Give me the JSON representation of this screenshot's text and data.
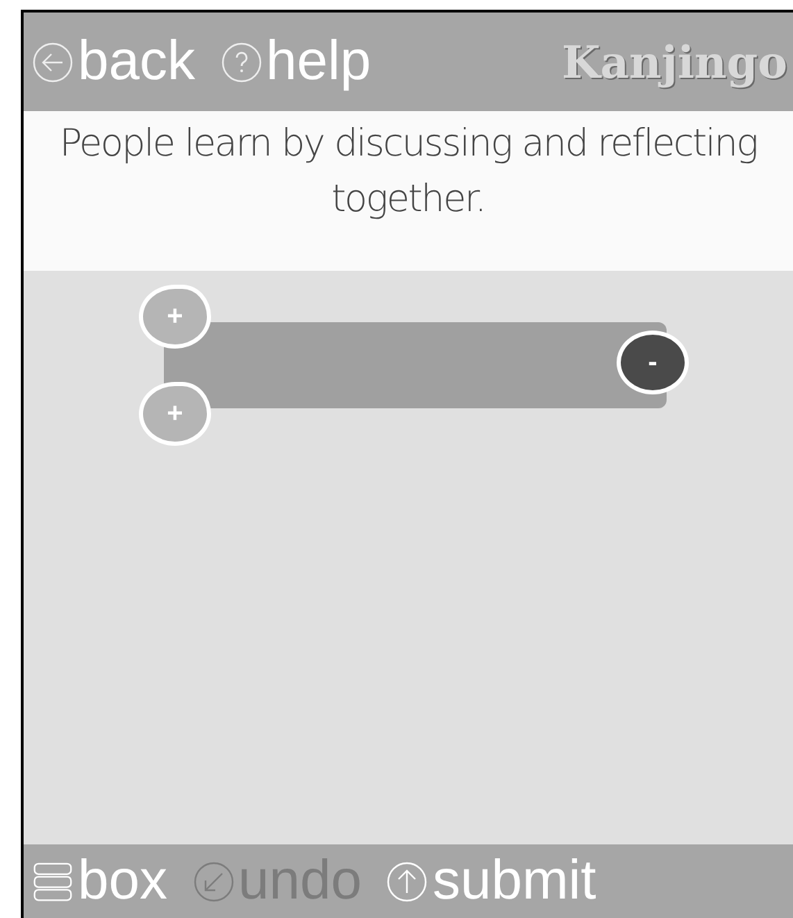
{
  "header": {
    "buttons": [
      {
        "kind": "back",
        "label": "back"
      },
      {
        "kind": "help",
        "label": "help"
      }
    ],
    "logo": "Kanjingo"
  },
  "prompt": "People learn by discussing and reflecting together.",
  "canvas": {
    "block": {
      "left_handles": [
        "+",
        "+"
      ],
      "right_handle": "-"
    }
  },
  "footer": {
    "buttons": [
      {
        "kind": "box",
        "label": "box",
        "disabled": false
      },
      {
        "kind": "undo",
        "label": "undo",
        "disabled": true
      },
      {
        "kind": "submit",
        "label": "submit",
        "disabled": false
      }
    ]
  }
}
